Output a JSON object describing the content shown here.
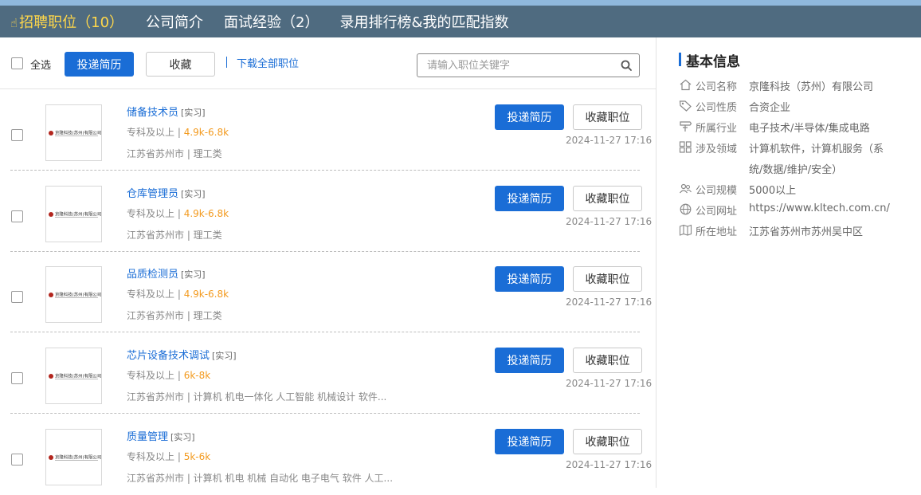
{
  "nav": {
    "tabs": [
      {
        "label": "招聘职位（10）",
        "icon": "hand-pointer-icon",
        "active": true
      },
      {
        "label": "公司简介"
      },
      {
        "label": "面试经验（2）"
      },
      {
        "label": "录用排行榜&我的匹配指数"
      }
    ]
  },
  "toolbar": {
    "select_all": "全选",
    "apply_label": "投递简历",
    "favorite_label": "收藏",
    "download_link": "下载全部职位",
    "search_placeholder": "请输入职位关键字"
  },
  "logo_text": "京隆科技(苏州)有限公司",
  "jobs": [
    {
      "title": "储备技术员",
      "tag": "[实习]",
      "education": "专科及以上",
      "salary": "4.9k-6.8k",
      "location": "江苏省苏州市 | 理工类",
      "date": "2024-11-27  17:16",
      "apply_label": "投递简历",
      "fav_label": "收藏职位"
    },
    {
      "title": "仓库管理员",
      "tag": "[实习]",
      "education": "专科及以上",
      "salary": "4.9k-6.8k",
      "location": "江苏省苏州市 | 理工类",
      "date": "2024-11-27  17:16",
      "apply_label": "投递简历",
      "fav_label": "收藏职位"
    },
    {
      "title": "品质检测员",
      "tag": "[实习]",
      "education": "专科及以上",
      "salary": "4.9k-6.8k",
      "location": "江苏省苏州市 | 理工类",
      "date": "2024-11-27  17:16",
      "apply_label": "投递简历",
      "fav_label": "收藏职位"
    },
    {
      "title": "芯片设备技术调试",
      "tag": "[实习]",
      "education": "专科及以上",
      "salary": "6k-8k",
      "location": "江苏省苏州市 | 计算机 机电一体化 人工智能 机械设计 软件...",
      "date": "2024-11-27  17:16",
      "apply_label": "投递简历",
      "fav_label": "收藏职位"
    },
    {
      "title": "质量管理",
      "tag": "[实习]",
      "education": "专科及以上",
      "salary": "5k-6k",
      "location": "江苏省苏州市 | 计算机 机电 机械 自动化 电子电气 软件 人工...",
      "date": "2024-11-27  17:16",
      "apply_label": "投递简历",
      "fav_label": "收藏职位"
    }
  ],
  "info": {
    "title": "基本信息",
    "rows": [
      {
        "icon": "home-icon",
        "label": "公司名称",
        "value": "京隆科技（苏州）有限公司"
      },
      {
        "icon": "tag-icon",
        "label": "公司性质",
        "value": "合资企业"
      },
      {
        "icon": "signpost-icon",
        "label": "所属行业",
        "value": "电子技术/半导体/集成电路"
      },
      {
        "icon": "grid-icon",
        "label": "涉及领域",
        "value": "计算机软件，计算机服务（系",
        "value2": "统/数据/维护/安全）"
      },
      {
        "icon": "people-icon",
        "label": "公司规模",
        "value": "5000以上"
      },
      {
        "icon": "globe-icon",
        "label": "公司网址",
        "value": "https://www.kltech.com.cn/"
      },
      {
        "icon": "map-icon",
        "label": "所在地址",
        "value": "江苏省苏州市苏州吴中区"
      }
    ]
  }
}
